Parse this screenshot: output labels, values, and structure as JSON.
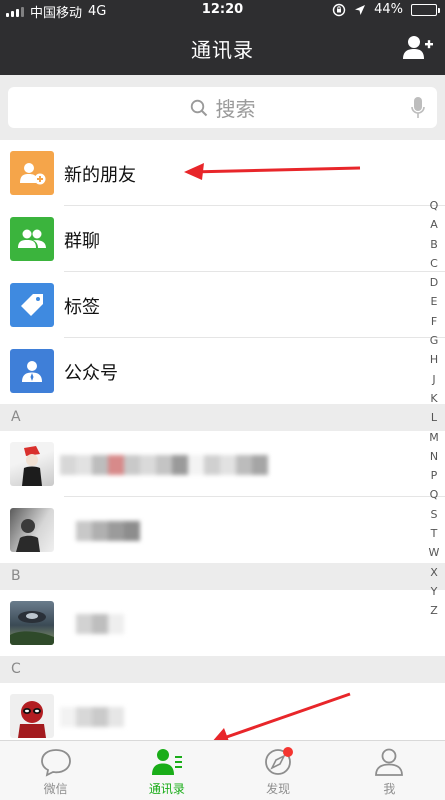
{
  "status_bar": {
    "carrier": "中国移动",
    "network": "4G",
    "time": "12:20",
    "battery": "44%",
    "battery_level": 0.44
  },
  "header": {
    "title": "通讯录",
    "add_icon": "add-contact-icon"
  },
  "search": {
    "placeholder": "搜索"
  },
  "features": [
    {
      "label": "新的朋友",
      "icon": "new-friend-icon",
      "color": "#f5a54a"
    },
    {
      "label": "群聊",
      "icon": "group-chat-icon",
      "color": "#3bb43d"
    },
    {
      "label": "标签",
      "icon": "tag-icon",
      "color": "#3f8ae0"
    },
    {
      "label": "公众号",
      "icon": "official-account-icon",
      "color": "#3f7fd8"
    }
  ],
  "sections": [
    {
      "letter": "A",
      "contacts": 2
    },
    {
      "letter": "B",
      "contacts": 1
    },
    {
      "letter": "C",
      "contacts": 1
    }
  ],
  "index_letters": [
    "Q",
    "A",
    "B",
    "C",
    "D",
    "E",
    "F",
    "G",
    "H",
    "J",
    "K",
    "L",
    "M",
    "N",
    "P",
    "Q",
    "S",
    "T",
    "W",
    "X",
    "Y",
    "Z"
  ],
  "tabs": [
    {
      "label": "微信",
      "icon": "chat-bubble-icon"
    },
    {
      "label": "通讯录",
      "icon": "contacts-icon",
      "active": true
    },
    {
      "label": "发现",
      "icon": "compass-icon",
      "badge": true
    },
    {
      "label": "我",
      "icon": "person-icon"
    }
  ],
  "colors": {
    "accent": "#1aad19",
    "header_bg": "#2e2e30",
    "badge": "#f43530",
    "annotation_arrow": "#e8262a"
  }
}
